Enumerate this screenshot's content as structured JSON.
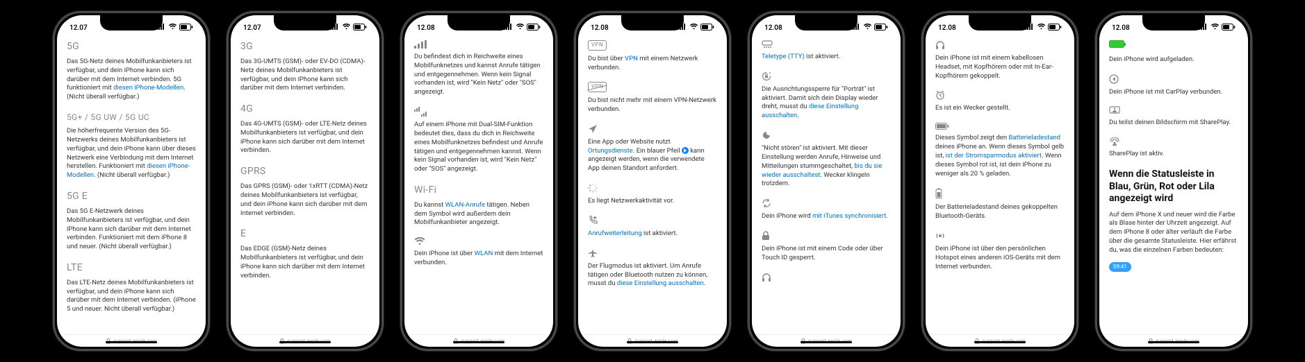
{
  "phones": [
    {
      "time": "12.07",
      "url": "support.apple.com",
      "entries": [
        {
          "head": "5G",
          "desc": "Das 5G-Netz deines Mobilfunkanbieters ist verfügbar, und dein iPhone kann sich darüber mit dem Internet verbinden. 5G funktioniert mit ",
          "link1": "diesen iPhone-Modellen",
          "tail": ". (Nicht überall verfügbar.)"
        },
        {
          "head": "5G+ / 5G UW / 5G UC",
          "headClass": "small",
          "desc": "Die höherfrequente Version des 5G-Netzwerks deines Mobilfunkanbieters ist verfügbar, und dein iPhone kann über dieses Netzwerk eine Verbindung mit dem Internet herstellen. Funktioniert mit ",
          "link1": "diesen iPhone-Modellen",
          "tail": ". (Nicht überall verfügbar.)"
        },
        {
          "head": "5G E",
          "desc": "Das 5G E-Netzwerk deines Mobilfunkanbieters ist verfügbar, und dein iPhone kann sich darüber mit dem Internet verbinden. Funktioniert mit dem iPhone 8 und neuer. (Nicht überall verfügbar.)"
        },
        {
          "head": "LTE",
          "desc": "Das LTE-Netz deines Mobilfunkanbieters ist verfügbar, und dein iPhone kann sich darüber mit dem Internet verbinden. (iPhone 5 und neuer. Nicht überall verfügbar.)"
        }
      ]
    },
    {
      "time": "12.07",
      "url": "support.apple.com",
      "entries": [
        {
          "head": "3G",
          "desc": "Das 3G-UMTS (GSM)- oder EV-DO (CDMA)-Netz deines Mobilfunkanbieters ist verfügbar, und dein iPhone kann sich darüber mit dem Internet verbinden."
        },
        {
          "head": "4G",
          "desc": "Das 4G-UMTS (GSM)- oder LTE-Netz deines Mobilfunkanbieters ist verfügbar, und dein iPhone kann sich darüber mit dem Internet verbinden."
        },
        {
          "head": "GPRS",
          "desc": "Das GPRS (GSM)- oder 1xRTT (CDMA)-Netz deines Mobilfunkanbieters ist verfügbar, und dein iPhone kann sich darüber mit dem Internet verbinden."
        },
        {
          "head": "E",
          "desc": "Das EDGE (GSM)-Netz deines Mobilfunkanbieters ist verfügbar, und dein iPhone kann sich darüber mit dem Internet verbinden."
        }
      ]
    },
    {
      "time": "12.08",
      "url": "support.apple.com",
      "entries": [
        {
          "icon": "cell-bars",
          "desc": "Du befindest dich in Reichweite eines Mobilfunknetzes und kannst Anrufe tätigen und entgegennehmen. Wenn kein Signal vorhanden ist, wird \"Kein Netz\" oder \"SOS\" angezeigt."
        },
        {
          "icon": "dual-bars",
          "desc": "Auf einem iPhone mit Dual-SIM-Funktion bedeutet dies, dass du dich in Reichweite eines Mobilfunknetzes befindest und Anrufe tätigen und entgegennehmen kannst. Wenn kein Signal vorhanden ist, wird \"Kein Netz\" oder \"SOS\" angezeigt."
        },
        {
          "head": "Wi-Fi",
          "desc": "Du kannst ",
          "link1": "WLAN-Anrufe",
          "tail": " tätigen. Neben dem Symbol wird außerdem dein Mobilfunkanbieter angezeigt."
        },
        {
          "icon": "wifi",
          "desc": "Dein iPhone ist über ",
          "link1": "WLAN",
          "tail": " mit dem Internet verbunden."
        }
      ]
    },
    {
      "time": "12.08",
      "url": "support.apple.com",
      "entries": [
        {
          "icon": "vpn",
          "desc": "Du bist über ",
          "link1": "VPN",
          "tail": " mit einem Netzwerk verbunden."
        },
        {
          "icon": "vpn-off",
          "desc": "Du bist nicht mehr mit einem VPN-Netzwerk verbunden."
        },
        {
          "icon": "location",
          "desc": "Eine App oder Website nutzt ",
          "link1": "Ortungsdienste",
          "tail": ". Ein blauer Pfeil ",
          "dot": true,
          "tail2": " kann angezeigt werden, wenn die verwendete App deinen Standort anfordert."
        },
        {
          "icon": "spinner",
          "desc": "Es liegt Netzwerkaktivität vor."
        },
        {
          "icon": "call-fwd",
          "link1": "Anrufweiterleitung",
          "tail": " ist aktiviert."
        },
        {
          "icon": "airplane",
          "desc": "Der Flugmodus ist aktiviert. Um Anrufe tätigen oder Bluetooth nutzen zu können, musst du ",
          "link1": "diese Einstellung ausschalten",
          "tail": "."
        }
      ]
    },
    {
      "time": "12.08",
      "url": "support.apple.com",
      "entries": [
        {
          "icon": "tty",
          "link1": "Teletype (TTY)",
          "tail": " ist aktiviert."
        },
        {
          "icon": "orient-lock",
          "desc": "Die Ausrichtungssperre für \"Porträt\" ist aktiviert. Damit sich dein Display wieder dreht, musst du ",
          "link1": "diese Einstellung ausschalten",
          "tail": "."
        },
        {
          "icon": "dnd",
          "desc": "\"Nicht stören\" ist aktiviert. Mit dieser Einstellung werden Anrufe, Hinweise und Mitteilungen stummgeschaltet, ",
          "link1": "bis du sie wieder ausschaltest",
          "tail": ". Wecker klingeln trotzdem."
        },
        {
          "icon": "sync",
          "desc": "Dein iPhone wird ",
          "link1": "mit iTunes synchronisiert",
          "tail": "."
        },
        {
          "icon": "lock",
          "desc": "Dein iPhone ist mit einem Code oder über Touch ID gesperrt."
        },
        {
          "icon": "headphones",
          "desc": ""
        }
      ]
    },
    {
      "time": "12.08",
      "url": "support.apple.com",
      "entries": [
        {
          "icon": "headphones",
          "desc": "Dein iPhone ist mit einem kabellosen Headset, mit Kopfhörern oder mit In-Ear-Kopfhörern gekoppelt."
        },
        {
          "icon": "alarm",
          "desc": "Es ist ein Wecker gestellt."
        },
        {
          "icon": "battery",
          "desc": "Dieses Symbol zeigt den ",
          "link1": "Batterieladestand",
          "tail": " deines iPhone an. Wenn dieses Symbol gelb ist, ",
          "link2": "ist der Stromsparmodus aktiviert",
          "tail2": ". Wenn dieses Symbol rot ist, ist dein iPhone zu weniger als 20 % geladen."
        },
        {
          "icon": "bt-batt",
          "desc": "Der Batterieladestand deines gekoppelten Bluetooth-Geräts."
        },
        {
          "icon": "hotspot",
          "desc": "Dein iPhone ist über den persönlichen Hotspot eines anderen iOS-Geräts mit dem Internet verbunden."
        }
      ]
    },
    {
      "time": "12.08",
      "url": "support.apple.com",
      "entries": [
        {
          "icon": "charge",
          "desc": "Dein iPhone wird aufgeladen."
        },
        {
          "icon": "carplay",
          "desc": "Dein iPhone ist mit CarPlay verbunden."
        },
        {
          "icon": "shareplay-screen",
          "desc": "Du teilst deinen Bildschirm mit SharePlay."
        },
        {
          "icon": "shareplay",
          "desc": "SharePlay ist aktiv."
        }
      ],
      "h2": "Wenn die Statusleiste in Blau, Grün, Rot oder Lila angezeigt wird",
      "para": "Auf dem iPhone X und neuer wird die Farbe als Blase hinter der Uhrzeit angezeigt. Auf dem iPhone 8 oder älter verläuft die Farbe über die gesamte Statusleiste. Hier erfährst du, was die einzelnen Farben bedeuten:",
      "pill": "09:41"
    }
  ]
}
